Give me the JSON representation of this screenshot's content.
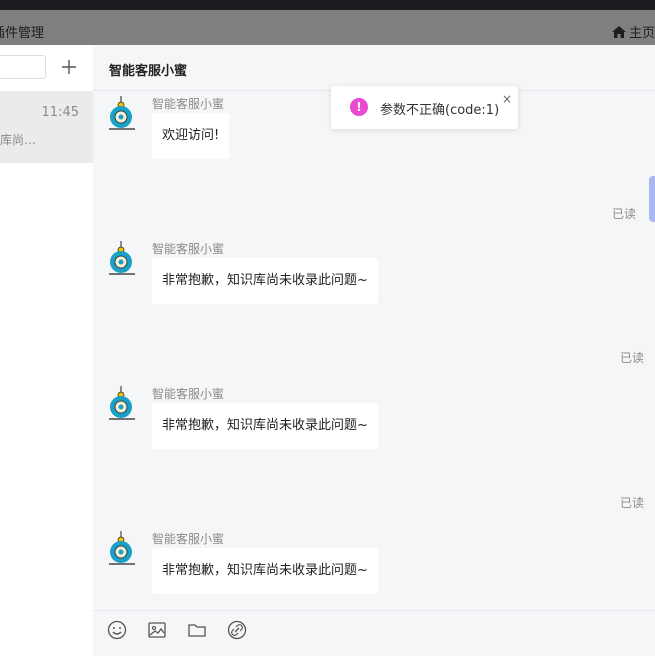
{
  "menubar": {
    "left_label": "插件管理",
    "right_label": "主页"
  },
  "sidebar": {
    "conversation": {
      "time": "11:45",
      "preview": "库尚…"
    }
  },
  "chat": {
    "title": "智能客服小蜜",
    "messages": [
      {
        "sender": "智能客服小蜜",
        "text": "欢迎访问!"
      },
      {
        "sender": "智能客服小蜜",
        "text": "非常抱歉，知识库尚未收录此问题~"
      },
      {
        "sender": "智能客服小蜜",
        "text": "非常抱歉，知识库尚未收录此问题~"
      },
      {
        "sender": "智能客服小蜜",
        "text": "非常抱歉，知识库尚未收录此问题~"
      }
    ],
    "read_labels": [
      "已读",
      "已读",
      "已读"
    ]
  },
  "composer": {
    "tools": [
      "emoji-icon",
      "image-icon",
      "folder-icon",
      "link-icon"
    ]
  },
  "toast": {
    "icon": "!",
    "text": "参数不正确(code:1)",
    "close": "×"
  },
  "colors": {
    "toast_icon": "#e84ad1",
    "avatar": "#1aa0c4",
    "accent_tab": "#aab8f2"
  }
}
